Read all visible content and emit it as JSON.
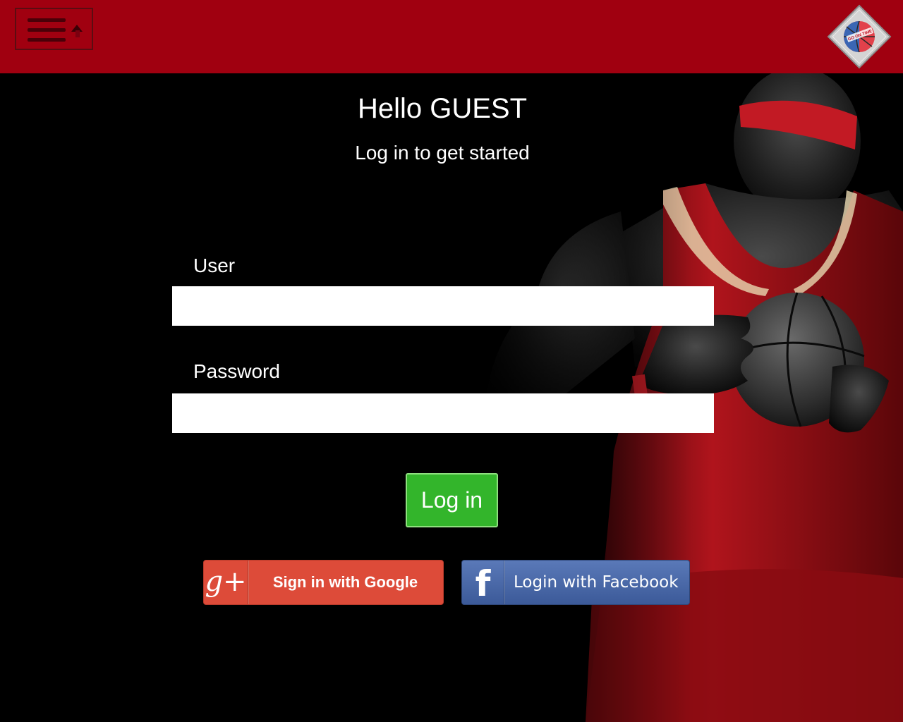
{
  "header": {
    "menu_icon": "hamburger-menu-icon",
    "logo_text": "GO ON TIME",
    "background_color": "#a00010"
  },
  "main": {
    "greeting": "Hello GUEST",
    "subtitle": "Log in to get started",
    "user_label": "User",
    "user_value": "",
    "password_label": "Password",
    "password_value": "",
    "login_label": "Log in",
    "login_color": "#33b52b"
  },
  "social": {
    "google": {
      "icon": "google-plus-icon",
      "icon_glyph": "g+",
      "label": "Sign in with Google",
      "color": "#dd4b39"
    },
    "facebook": {
      "icon": "facebook-icon",
      "icon_glyph": "f",
      "label": "Login with Facebook",
      "color": "#3c5a99"
    }
  },
  "background": {
    "image": "basketball-player-photo"
  }
}
